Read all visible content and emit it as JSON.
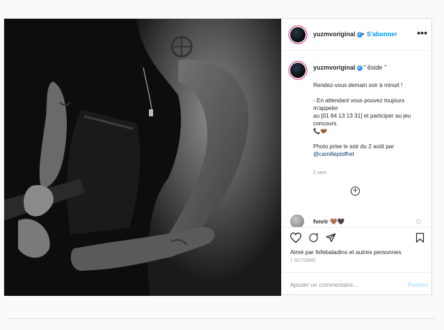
{
  "post": {
    "username": "yuzmvoriginal",
    "follow_label": "S'abonner",
    "separator": "•",
    "more": "•••",
    "caption_title": "\" 6side \"",
    "caption_body": "Rendez-vous demain soir à minuit !\n\n- En attendant vous pouvez toujours m'appeler\nau [01 84 13 13 31] et participer au jeu concours.\n📞🤝🏾\n\nPhoto prise le soir du 2 août par",
    "caption_mention": "@camillepioffret",
    "time_ago": "2 sem",
    "load_more": "+",
    "comment": {
      "username": "fvnrir",
      "text": "🤎🖤",
      "heart": "♡"
    },
    "likes_text": "Aimé par fefebaladins et autres personnes",
    "date": "7 OCTOBRE",
    "add_comment_placeholder": "Ajouter un commentaire...",
    "publish_label": "Publier"
  },
  "icons": {
    "like": "♡",
    "comment": "💬",
    "share": "➤",
    "save": "🔖"
  },
  "colors": {
    "link": "#0095f6",
    "verified": "#3897f0",
    "publish_disabled": "#b2dffc"
  }
}
